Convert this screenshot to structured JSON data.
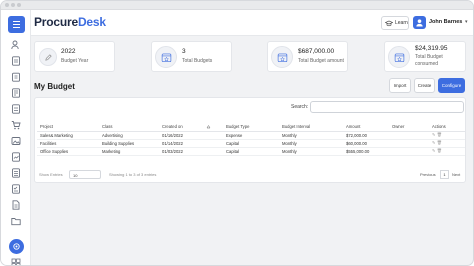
{
  "app": {
    "logo_main": "Procure",
    "logo_accent": "Desk"
  },
  "topbar": {
    "learn_label": "Learn",
    "user_name": "John Barnes",
    "chevron": "▾"
  },
  "cards": [
    {
      "value": "2022",
      "caption": "Budget Year",
      "icon": "edit-icon"
    },
    {
      "value": "3",
      "caption": "Total Budgets",
      "icon": "budget-icon"
    },
    {
      "value": "$687,000.00",
      "caption": "Total Budget amount",
      "icon": "budget-icon"
    },
    {
      "value": "$24,319.95",
      "caption": "Total Budget",
      "caption2": "consumed",
      "icon": "budget-icon"
    }
  ],
  "section": {
    "title": "My Budget"
  },
  "buttons": {
    "import": "Import",
    "create": "Create",
    "configure": "Configure"
  },
  "search": {
    "label": "Search:",
    "value": ""
  },
  "table": {
    "headers": [
      "Project",
      "Class",
      "Created on",
      "Budget Type",
      "Budget Interval",
      "Amount",
      "Owner",
      "Actions"
    ],
    "rows": [
      [
        "Sales& Marketing",
        "Advertising",
        "01/16/2022",
        "Expense",
        "Monthly",
        "$72,000.00",
        ""
      ],
      [
        "Facilities",
        "Building Supplies",
        "01/14/2022",
        "Capital",
        "Monthly",
        "$60,000.00",
        ""
      ],
      [
        "Office Supplies",
        "Marketing",
        "01/03/2022",
        "Capital",
        "Monthly",
        "$555,000.00",
        ""
      ]
    ]
  },
  "pagination": {
    "show_label": "Show Entries",
    "per_page": "10",
    "info": "Showing 1 to 3 of 3 entries",
    "prev": "Previous",
    "page": "1",
    "next": "Next"
  }
}
